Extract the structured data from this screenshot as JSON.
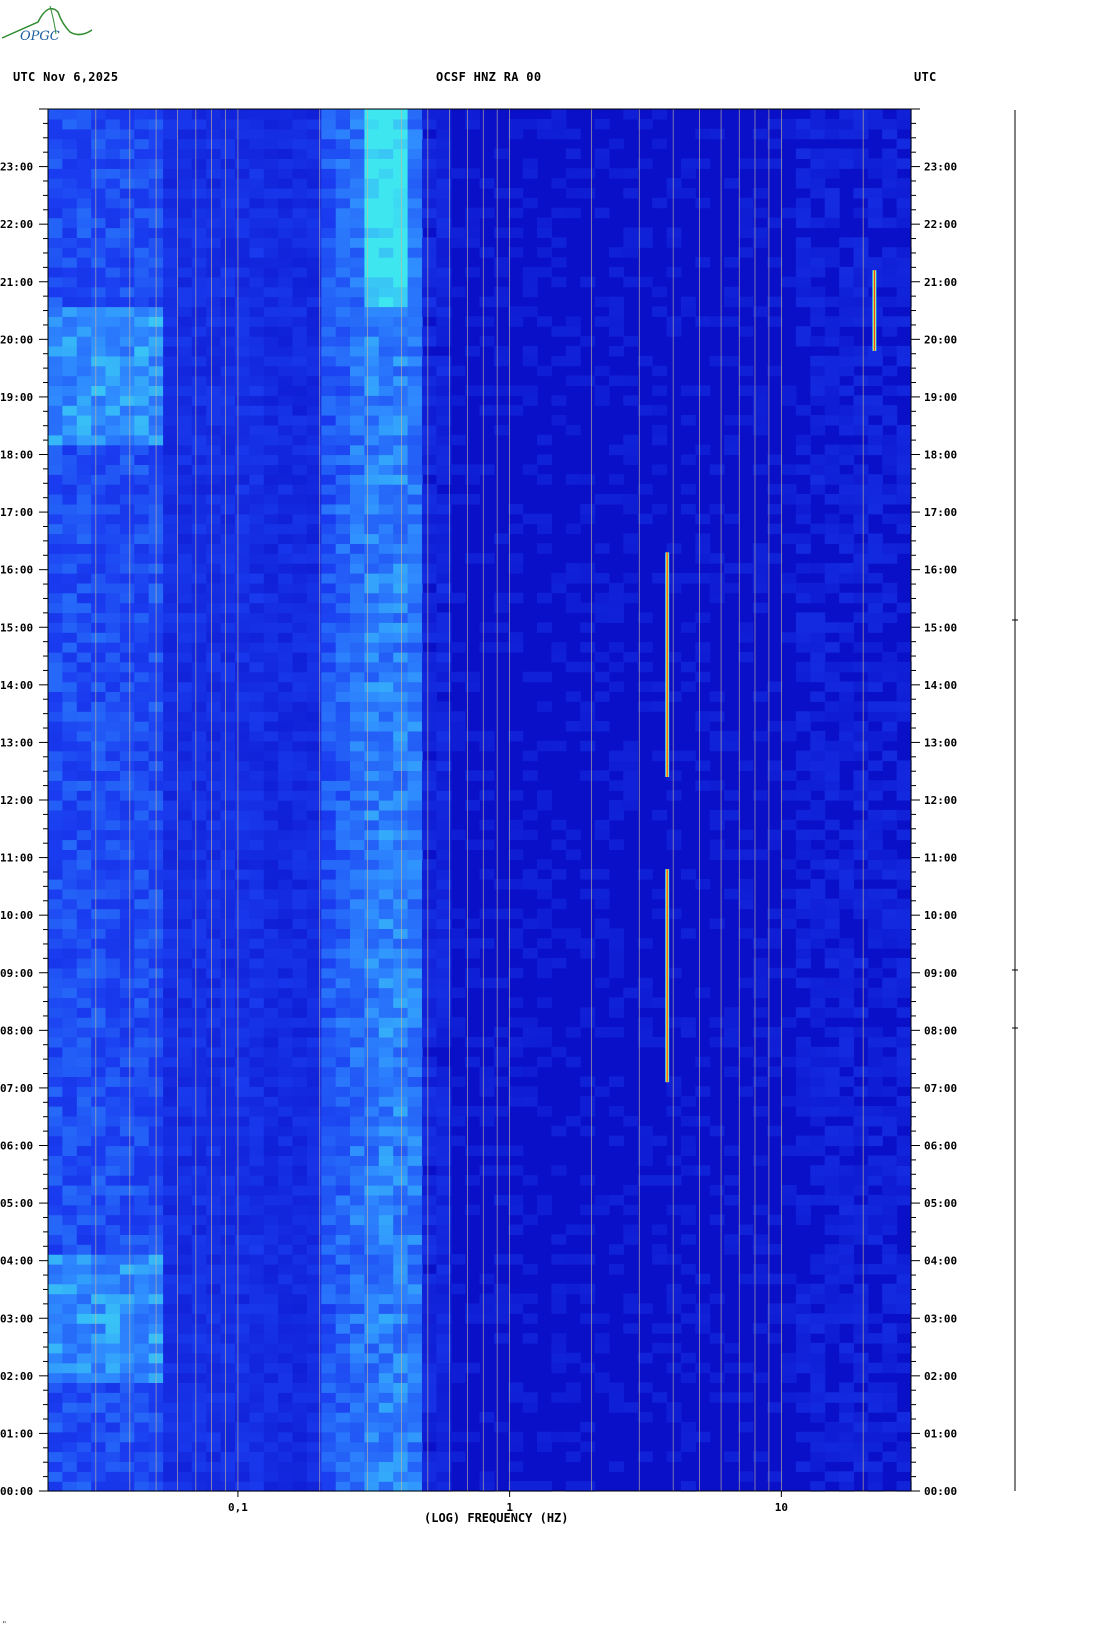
{
  "header": {
    "left": "UTC  Nov 6,2025",
    "center": "OCSF HNZ RA 00",
    "right": "UTC"
  },
  "logo_text": "OPGC",
  "footer_mark": "\"",
  "colors": {
    "background_low": "#0a10c8",
    "background_mid": "#1a3cf0",
    "noise_band": "#2f8bff",
    "energy_high": "#3ee6f0",
    "line_red": "#ff2a1a",
    "line_yellow": "#f6ef3a",
    "grid_line": "#c8b89a",
    "logo_green": "#2e8b2e"
  },
  "chart_data": {
    "type": "heatmap",
    "title": "OCSF HNZ RA 00",
    "xlabel": "(LOG) FREQUENCY (HZ)",
    "ylabel": "UTC",
    "x_scale": "log",
    "x_range_hz": [
      0.02,
      30
    ],
    "x_tick_labels": [
      "0,1",
      "1",
      "10"
    ],
    "x_ticks_hz": [
      0.1,
      1,
      10
    ],
    "y_range_hours": [
      0,
      24
    ],
    "y_tick_labels": [
      "00:00",
      "01:00",
      "02:00",
      "03:00",
      "04:00",
      "05:00",
      "06:00",
      "07:00",
      "08:00",
      "09:00",
      "10:00",
      "11:00",
      "12:00",
      "13:00",
      "14:00",
      "15:00",
      "16:00",
      "17:00",
      "18:00",
      "19:00",
      "20:00",
      "21:00",
      "22:00",
      "23:00"
    ],
    "grid": true,
    "features": [
      {
        "name": "microseism band",
        "freq_hz": [
          0.2,
          0.45
        ],
        "time_h": [
          0,
          24
        ]
      },
      {
        "name": "narrowband line",
        "freq_hz": 3.8,
        "time_h": [
          12.4,
          16.3
        ]
      },
      {
        "name": "narrowband line",
        "freq_hz": 3.8,
        "time_h": [
          7.1,
          10.8
        ]
      },
      {
        "name": "narrowband line",
        "freq_hz": 22,
        "time_h": [
          19.8,
          21.2
        ]
      }
    ]
  }
}
